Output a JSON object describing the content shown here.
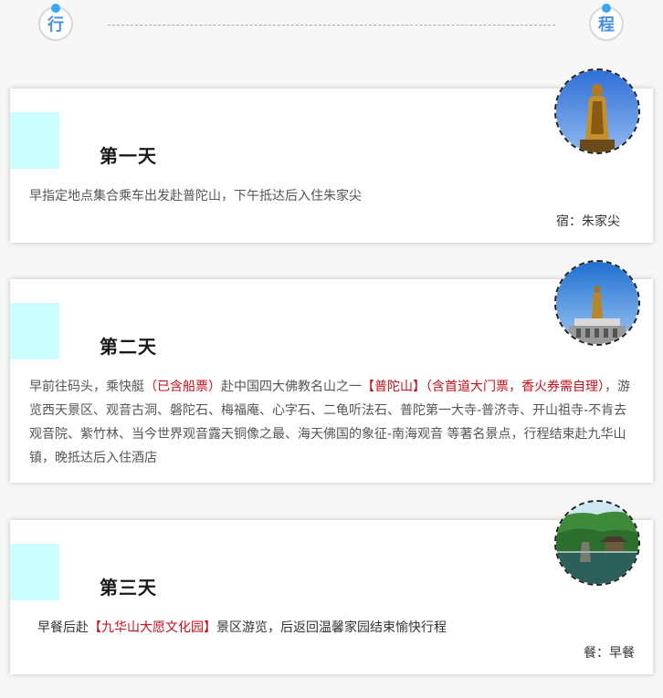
{
  "header": {
    "left_badge": "行",
    "right_badge": "程"
  },
  "days": [
    {
      "title": "第一天",
      "desc_segments": [
        {
          "text": "早指定地点集合乘车出发赴普陀山，下午抵达后入住朱家尖",
          "highlight": false
        }
      ],
      "footnote": "宿：朱家尖",
      "photo_icon": "buddha-statue-photo"
    },
    {
      "title": "第二天",
      "desc_segments": [
        {
          "text": "早前往码头，乘快艇",
          "highlight": false
        },
        {
          "text": "（已含船票）",
          "highlight": true
        },
        {
          "text": "赴中国四大佛教名山之一",
          "highlight": false
        },
        {
          "text": "【普陀山】（含首道大门票，香火券需自理）",
          "highlight": true
        },
        {
          "text": "，游览西天景区、观音古洞、磐陀石、梅福庵、心字石、二龟听法石、普陀第一大寺-普济寺、开山祖寺-不肯去观音院、紫竹林、当今世界观音露天铜像之最、海天佛国的象征-南海观音 等著名景点，行程结束赴九华山镇，晚抵达后入住酒店",
          "highlight": false
        }
      ],
      "footnote": "",
      "photo_icon": "guanyin-statue-photo"
    },
    {
      "title": "第三天",
      "desc_segments": [
        {
          "text": "早餐后赴",
          "highlight": false
        },
        {
          "text": "【九华山大愿文化园】",
          "highlight": true
        },
        {
          "text": "景区游览，后返回温馨家园结束愉快行程",
          "highlight": false
        }
      ],
      "footnote": "餐：早餐",
      "photo_icon": "pavilion-lake-photo"
    }
  ],
  "colors": {
    "accent_block": "#ccfdff",
    "highlight": "#c0121b",
    "badge_text": "#4a90e2",
    "badge_dot": "#3aa7f0"
  }
}
